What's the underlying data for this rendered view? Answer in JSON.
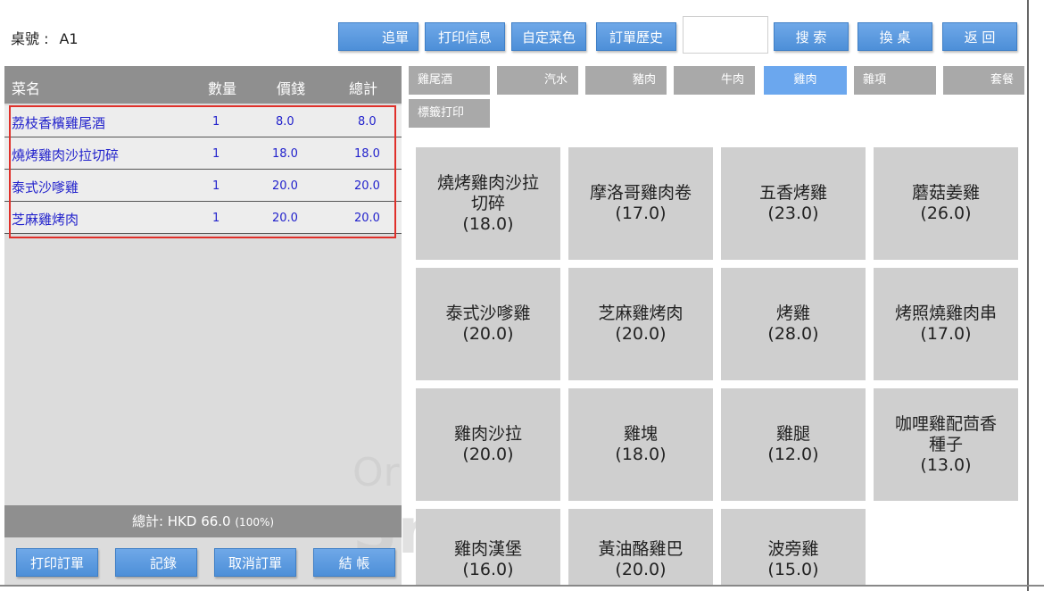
{
  "header": {
    "table_label": "桌號 :",
    "table_value": "A1",
    "buttons": {
      "add_order": "追單",
      "print_info": "打印信息",
      "custom_dish": "自定菜色",
      "order_history": "訂單歷史",
      "search": "搜 索",
      "change_table": "換 桌",
      "back": "返 回"
    },
    "search_value": ""
  },
  "order": {
    "columns": {
      "name": "菜名",
      "qty": "數量",
      "price": "價錢",
      "total": "總計"
    },
    "rows": [
      {
        "name": "荔枝香檳雞尾酒",
        "qty": "1",
        "price": "8.0",
        "total": "8.0"
      },
      {
        "name": "燒烤雞肉沙拉切碎",
        "qty": "1",
        "price": "18.0",
        "total": "18.0"
      },
      {
        "name": "泰式沙嗲雞",
        "qty": "1",
        "price": "20.0",
        "total": "20.0"
      },
      {
        "name": "芝麻雞烤肉",
        "qty": "1",
        "price": "20.0",
        "total": "20.0"
      }
    ],
    "total_label": "總計: HKD 66.0",
    "total_pct": "(100%)",
    "buttons": {
      "print_order": "打印訂單",
      "records": "記錄",
      "cancel_order": "取消訂單",
      "checkout": "結 帳"
    }
  },
  "watermark": {
    "line1": "Or",
    "line2": "Sn"
  },
  "categories": [
    {
      "label": "雞尾酒"
    },
    {
      "label": "汽水"
    },
    {
      "label": "豬肉"
    },
    {
      "label": "牛肉"
    },
    {
      "label": "雞肉"
    },
    {
      "label": "雜項"
    },
    {
      "label": "套餐"
    },
    {
      "label": "標籤打印"
    }
  ],
  "active_category": "雞肉",
  "dishes": [
    {
      "name": "燒烤雞肉沙拉\n切碎",
      "price": "18.0"
    },
    {
      "name": "摩洛哥雞肉卷",
      "price": "17.0"
    },
    {
      "name": "五香烤雞",
      "price": "23.0"
    },
    {
      "name": "蘑菇姜雞",
      "price": "26.0"
    },
    {
      "name": "泰式沙嗲雞",
      "price": "20.0"
    },
    {
      "name": "芝麻雞烤肉",
      "price": "20.0"
    },
    {
      "name": "烤雞",
      "price": "28.0"
    },
    {
      "name": "烤照燒雞肉串",
      "price": "17.0"
    },
    {
      "name": "雞肉沙拉",
      "price": "20.0"
    },
    {
      "name": "雞塊",
      "price": "18.0"
    },
    {
      "name": "雞腿",
      "price": "12.0"
    },
    {
      "name": "咖哩雞配茴香\n種子",
      "price": "13.0"
    },
    {
      "name": "雞肉漢堡",
      "price": "16.0"
    },
    {
      "name": "黃油酪雞巴",
      "price": "20.0"
    },
    {
      "name": "波旁雞",
      "price": "15.0"
    }
  ],
  "colors": {
    "button_blue": "#4d8fd8",
    "tab_active": "#6ba7ee",
    "tab_inactive": "#a9a9a9",
    "order_text": "#2222cc",
    "selection_border": "#e0302a"
  }
}
